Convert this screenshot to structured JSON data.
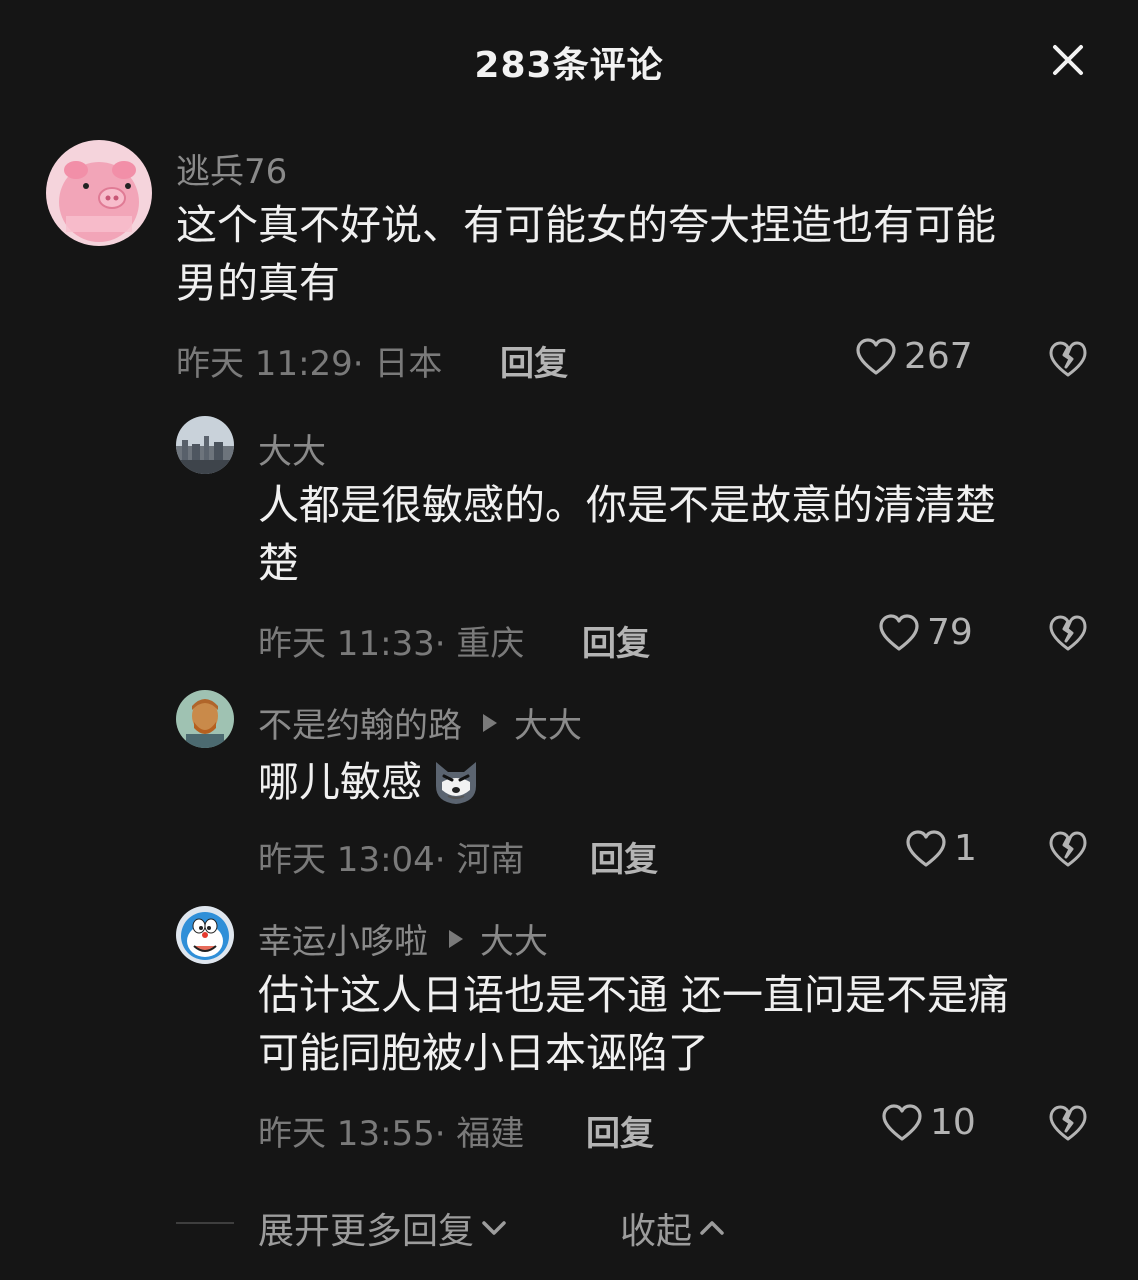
{
  "header": {
    "title": "283条评论"
  },
  "comments": [
    {
      "username": "逃兵76",
      "content_lines": [
        "这个真不好说、有可能女的夸大捏造也有可能",
        "男的真有"
      ],
      "time_location": "昨天 11:29· 日本",
      "reply_label": "回复",
      "likes": "267",
      "avatar_icon": "pink-pig-avatar"
    },
    {
      "username": "大大",
      "content_lines": [
        "人都是很敏感的。你是不是故意的清清楚",
        "楚"
      ],
      "time_location": "昨天 11:33· 重庆",
      "reply_label": "回复",
      "likes": "79",
      "avatar_icon": "city-skyline-avatar"
    },
    {
      "username": "不是约翰的路",
      "reply_to": "大大",
      "content_text": "哪儿敏感",
      "content_emoji": "wolf-face-emoji",
      "time_location": "昨天 13:04· 河南",
      "reply_label": "回复",
      "likes": "1",
      "avatar_icon": "portrait-painting-avatar"
    },
    {
      "username": "幸运小哆啦",
      "reply_to": "大大",
      "content_lines": [
        "估计这人日语也是不通 还一直问是不是痛",
        "可能同胞被小日本诬陷了"
      ],
      "time_location": "昨天 13:55· 福建",
      "reply_label": "回复",
      "likes": "10",
      "avatar_icon": "doraemon-avatar"
    }
  ],
  "footer": {
    "expand_label": "展开更多回复",
    "collapse_label": "收起"
  },
  "colors": {
    "background": "#151515",
    "text_primary": "#f0f0f0",
    "text_secondary": "#8a8a8a",
    "pig_pink": "#f2a5b8"
  }
}
